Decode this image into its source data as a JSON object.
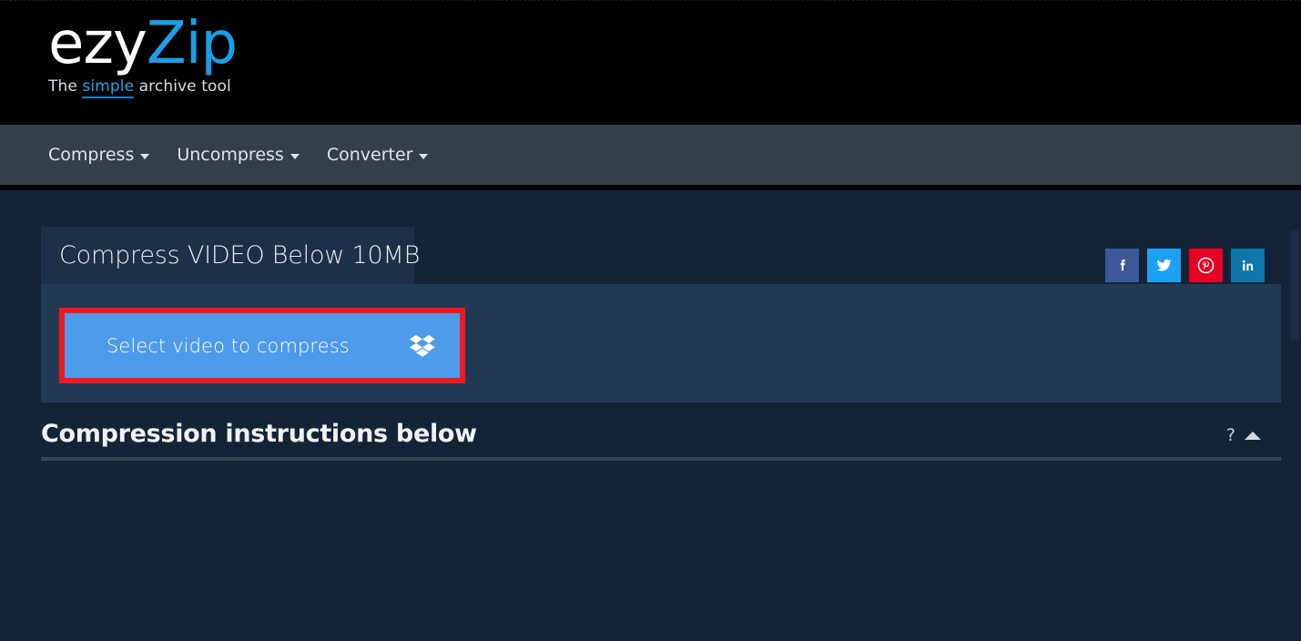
{
  "brand": {
    "logo_primary": "ezy",
    "logo_accent": "Zip",
    "tagline_prefix": "The ",
    "tagline_highlight": "simple",
    "tagline_suffix": " archive tool",
    "accent_color": "#1b9ee8"
  },
  "nav": {
    "items": [
      {
        "label": "Compress",
        "icon": "chevron-down-icon"
      },
      {
        "label": "Uncompress",
        "icon": "chevron-down-icon"
      },
      {
        "label": "Converter",
        "icon": "chevron-down-icon"
      }
    ]
  },
  "card": {
    "tab_title": "Compress VIDEO Below 10MB",
    "select_button": {
      "label": "Select video to compress",
      "icon": "dropbox-icon",
      "background_color": "#4d9bea",
      "highlight_border_color": "#f01922",
      "highlighted": true
    }
  },
  "social": {
    "items": [
      {
        "name": "facebook",
        "label": "f",
        "color": "#3b5998"
      },
      {
        "name": "twitter",
        "label": "Twitter",
        "color": "#1da1f2"
      },
      {
        "name": "pinterest",
        "label": "Pinterest",
        "color": "#e60023"
      },
      {
        "name": "linkedin",
        "label": "in",
        "color": "#0e76a8"
      }
    ]
  },
  "instructions": {
    "title": "Compression instructions below",
    "help_label": "?",
    "collapse_icon": "chevron-up-icon"
  },
  "theme": {
    "page_background": "#142436",
    "header_background": "#000000",
    "navbar_background": "#343f4b",
    "card_tab_background": "#1d3048",
    "card_body_background": "#233a55"
  }
}
